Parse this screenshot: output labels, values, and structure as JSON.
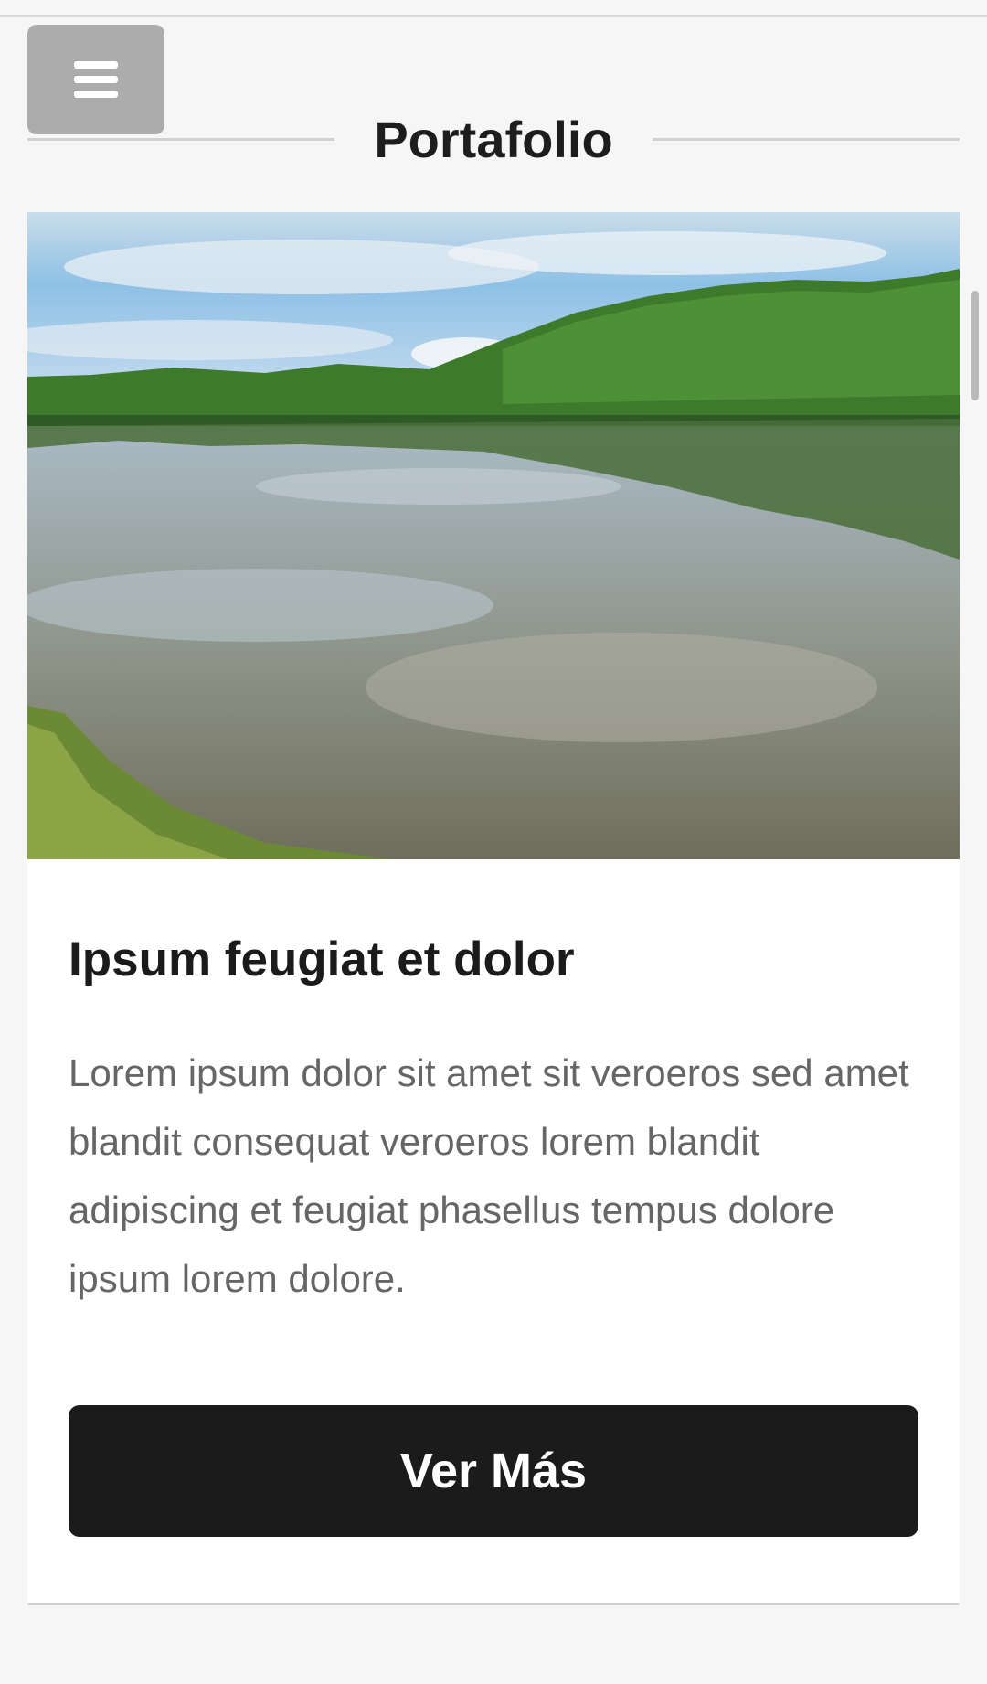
{
  "menu": {
    "icon": "hamburger-menu-icon",
    "button_color": "#acacac"
  },
  "section": {
    "title": "Portafolio"
  },
  "card": {
    "image_description": "lake with trees reflection",
    "title": "Ipsum feugiat et dolor",
    "text": "Lorem ipsum dolor sit amet sit veroeros sed amet blandit consequat veroeros lorem blandit adipiscing et feugiat phasellus tempus dolore ipsum lorem dolore.",
    "button_label": "Ver Más",
    "button_color": "#1b1b1b"
  }
}
